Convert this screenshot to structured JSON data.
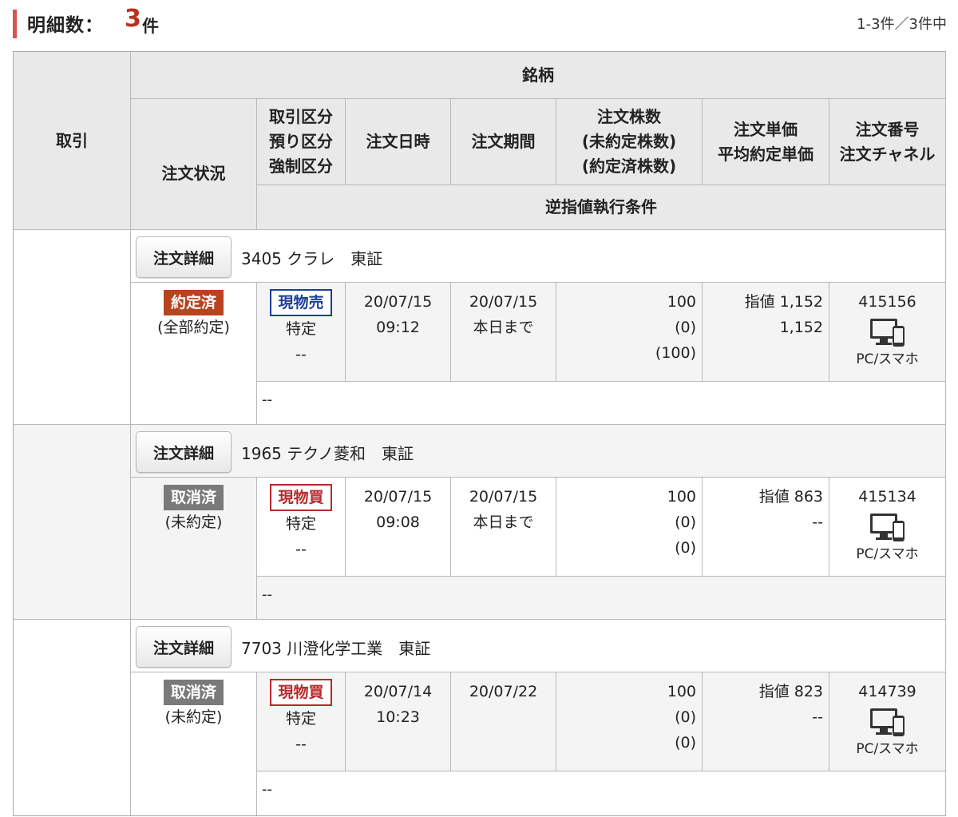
{
  "header": {
    "title": "明細数：",
    "count": "3",
    "count_unit": "件",
    "range": "1-3件／3件中",
    "accent_color": "#d9534f"
  },
  "table_header": {
    "torihiki": "取引",
    "meigara": "銘柄",
    "status": "注文状況",
    "kubun": [
      "取引区分",
      "預り区分",
      "強制区分"
    ],
    "order_datetime": "注文日時",
    "order_period": "注文期間",
    "shares": [
      "注文株数",
      "(未約定株数)",
      "(約定済株数)"
    ],
    "price": [
      "注文単価",
      "平均約定単価"
    ],
    "number": [
      "注文番号",
      "注文チャネル"
    ],
    "stop_condition": "逆指値執行条件"
  },
  "orders": [
    {
      "detail_button": "注文詳細",
      "stock": "3405 クラレ　東証",
      "status_badge": "約定済",
      "status_color": "#b8431f",
      "status_sub": "(全部約定)",
      "trade_type": "現物売",
      "trade_type_color": "#1c3d9c",
      "account": "特定",
      "forced": "--",
      "date": "20/07/15",
      "time": "09:12",
      "period_date": "20/07/15",
      "period_note": "本日まで",
      "qty": "100",
      "unfilled": "(0)",
      "filled": "(100)",
      "price": "指値 1,152",
      "avg_price": "1,152",
      "order_no": "415156",
      "channel_icon": "pc-smartphone-icon",
      "channel": "PC/スマホ",
      "stop_condition": "--"
    },
    {
      "detail_button": "注文詳細",
      "stock": "1965 テクノ菱和　東証",
      "status_badge": "取消済",
      "status_color": "#7a7a7a",
      "status_sub": "(未約定)",
      "trade_type": "現物買",
      "trade_type_color": "#b8282a",
      "account": "特定",
      "forced": "--",
      "date": "20/07/15",
      "time": "09:08",
      "period_date": "20/07/15",
      "period_note": "本日まで",
      "qty": "100",
      "unfilled": "(0)",
      "filled": "(0)",
      "price": "指値 863",
      "avg_price": "--",
      "order_no": "415134",
      "channel_icon": "pc-smartphone-icon",
      "channel": "PC/スマホ",
      "stop_condition": "--"
    },
    {
      "detail_button": "注文詳細",
      "stock": "7703 川澄化学工業　東証",
      "status_badge": "取消済",
      "status_color": "#7a7a7a",
      "status_sub": "(未約定)",
      "trade_type": "現物買",
      "trade_type_color": "#b8282a",
      "account": "特定",
      "forced": "--",
      "date": "20/07/14",
      "time": "10:23",
      "period_date": "20/07/22",
      "period_note": "",
      "qty": "100",
      "unfilled": "(0)",
      "filled": "(0)",
      "price": "指値 823",
      "avg_price": "--",
      "order_no": "414739",
      "channel_icon": "pc-smartphone-icon",
      "channel": "PC/スマホ",
      "stop_condition": "--"
    }
  ]
}
